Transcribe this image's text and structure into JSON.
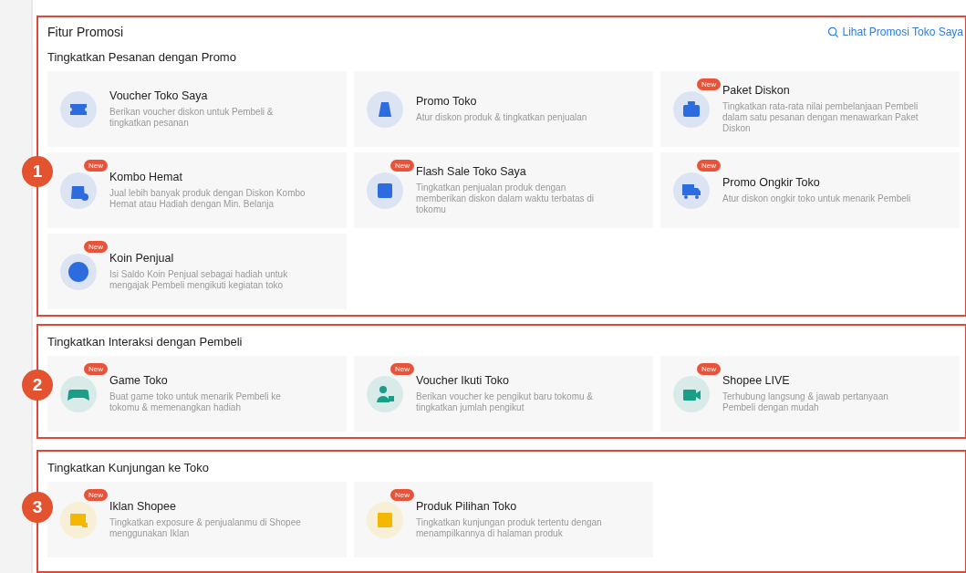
{
  "header": {
    "title": "Fitur Promosi",
    "link": "Lihat Promosi Toko Saya"
  },
  "sections": [
    {
      "number": "1",
      "title": "Tingkatkan Pesanan dengan Promo",
      "color": "#2d6cdf",
      "items": [
        {
          "kind": "ticket",
          "name": "Voucher Toko Saya",
          "desc": "Berikan voucher diskon untuk Pembeli & tingkatkan pesanan"
        },
        {
          "kind": "tag",
          "name": "Promo Toko",
          "desc": "Atur diskon produk & tingkatkan penjualan"
        },
        {
          "kind": "briefcase",
          "name": "Paket Diskon",
          "desc": "Tingkatkan rata-rata nilai pembelanjaan Pembeli dalam satu pesanan dengan menawarkan Paket Diskon",
          "badge": "New"
        },
        {
          "kind": "bag",
          "name": "Kombo Hemat",
          "desc": "Jual lebih banyak produk dengan Diskon Kombo Hemat atau Hadiah dengan Min. Belanja",
          "badge": "New"
        },
        {
          "kind": "store",
          "name": "Flash Sale Toko Saya",
          "desc": "Tingkatkan penjualan produk dengan memberikan diskon dalam waktu terbatas di tokomu",
          "badge": "New"
        },
        {
          "kind": "truck",
          "name": "Promo Ongkir Toko",
          "desc": "Atur diskon ongkir toko untuk menarik Pembeli",
          "badge": "New"
        },
        {
          "kind": "coin",
          "name": "Koin Penjual",
          "desc": "Isi Saldo Koin Penjual sebagai hadiah untuk mengajak Pembeli mengikuti kegiatan toko",
          "badge": "New"
        }
      ]
    },
    {
      "number": "2",
      "title": "Tingkatkan Interaksi dengan Pembeli",
      "color": "#1a9e8a",
      "items": [
        {
          "kind": "gamepad",
          "name": "Game Toko",
          "desc": "Buat game toko untuk menarik Pembeli ke tokomu & memenangkan hadiah",
          "badge": "New"
        },
        {
          "kind": "person",
          "name": "Voucher Ikuti Toko",
          "desc": "Berikan voucher ke pengikut baru tokomu & tingkatkan jumlah pengikut",
          "badge": "New"
        },
        {
          "kind": "video",
          "name": "Shopee LIVE",
          "desc": "Terhubung langsung & jawab pertanyaan Pembeli dengan mudah",
          "badge": "New"
        }
      ]
    },
    {
      "number": "3",
      "title": "Tingkatkan Kunjungan ke Toko",
      "color": "#f5b800",
      "items": [
        {
          "kind": "ad",
          "name": "Iklan Shopee",
          "desc": "Tingkatkan exposure & penjualanmu di Shopee menggunakan Iklan",
          "badge": "New"
        },
        {
          "kind": "star",
          "name": "Produk Pilihan Toko",
          "desc": "Tingkatkan kunjungan produk tertentu dengan menampilkannya di halaman produk",
          "badge": "New"
        }
      ]
    }
  ]
}
